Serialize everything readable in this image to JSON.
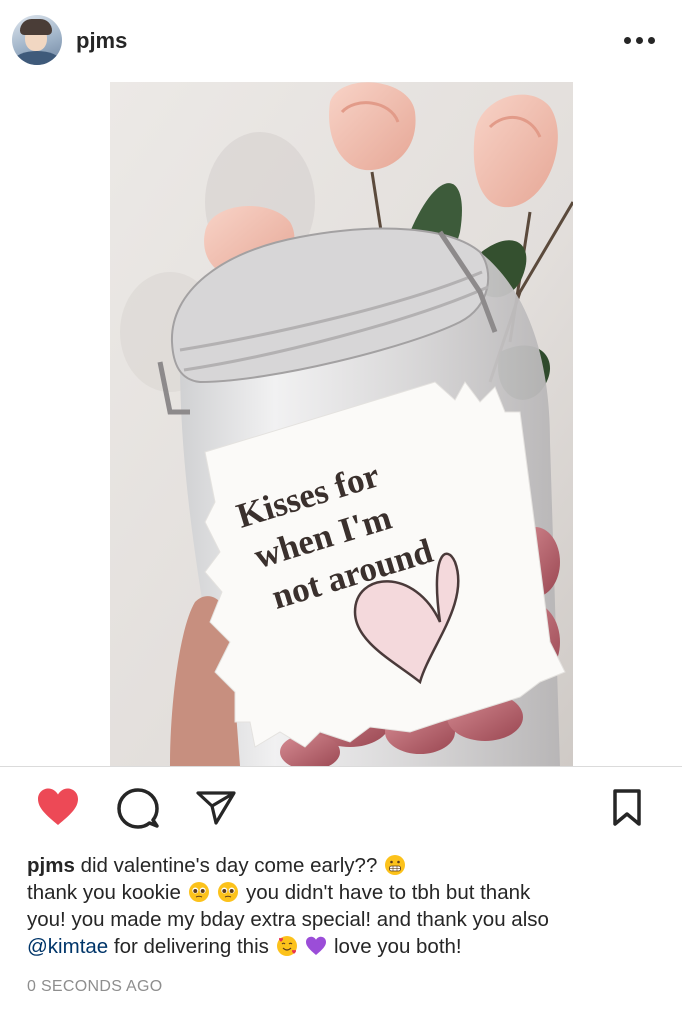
{
  "post": {
    "username": "pjms",
    "image_label": [
      "Kisses for",
      "when I'm",
      "not around"
    ]
  },
  "caption": {
    "username": "pjms",
    "line1_text": "did valentine's day come early??",
    "line2_a": "thank you kookie",
    "line2_b": "you didn't have to tbh but thank",
    "line3": "you! you made my bday extra special! and thank you also",
    "mention": "@kimtae",
    "line4_a": "for delivering this",
    "line4_b": "love you both!"
  },
  "timestamp": "0 SECONDS AGO",
  "icons": {
    "more": "more-options-icon",
    "like": "heart-icon",
    "comment": "comment-icon",
    "share": "paper-plane-icon",
    "save": "bookmark-icon"
  },
  "colors": {
    "like_red": "#ed4956",
    "mention_blue": "#003569",
    "muted_gray": "#8e8e8e"
  }
}
